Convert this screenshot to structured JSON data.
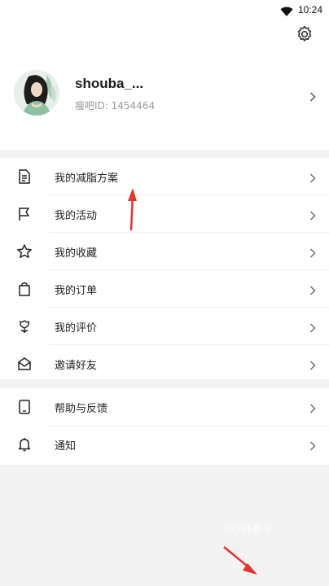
{
  "status_bar": {
    "time": "10:24"
  },
  "profile": {
    "username": "shouba_...",
    "user_id": "瘦吧ID: 1454464"
  },
  "menu_section_1": [
    {
      "label": "我的减脂方案",
      "icon": "document-icon"
    },
    {
      "label": "我的活动",
      "icon": "flag-icon"
    },
    {
      "label": "我的收藏",
      "icon": "star-icon"
    },
    {
      "label": "我的订单",
      "icon": "shopping-bag-icon"
    },
    {
      "label": "我的评价",
      "icon": "review-flower-icon"
    },
    {
      "label": "邀请好友",
      "icon": "envelope-icon"
    }
  ],
  "menu_section_2": [
    {
      "label": "帮助与反馈",
      "icon": "tablet-icon"
    },
    {
      "label": "通知",
      "icon": "bell-icon"
    }
  ],
  "watermark": "ROM助手",
  "colors": {
    "annotation_arrow": "#e3342f",
    "background": "#f3f3f3"
  }
}
